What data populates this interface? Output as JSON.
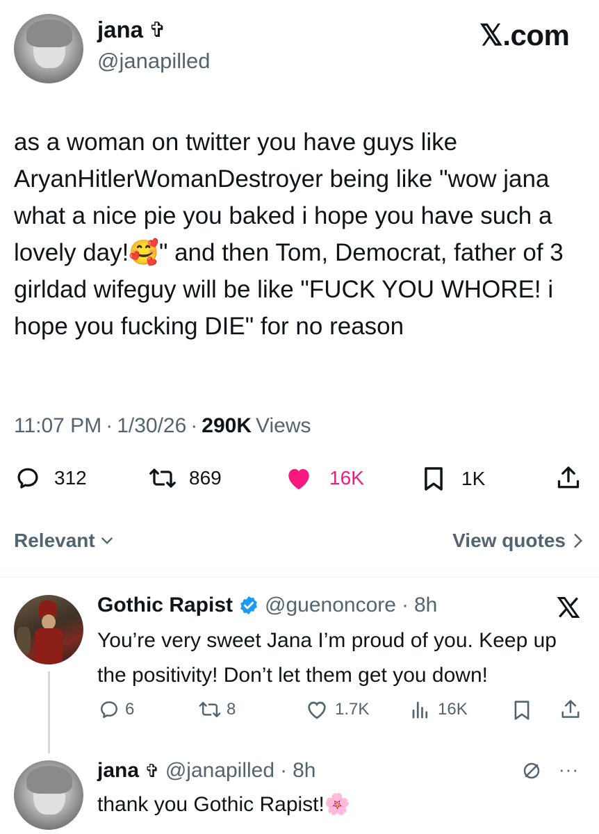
{
  "tweet": {
    "author_name": "jana",
    "author_badge": "✞",
    "handle": "@janapilled",
    "brand": "𝕏.com",
    "body": "as a woman on twitter you have guys like AryanHitlerWomanDestroyer being like \"wow jana what a nice pie you baked i hope you have such a lovely day!🥰\" and then Tom, Democrat, father of 3 girldad wifeguy will be like \"FUCK YOU WHORE! i hope you fucking DIE\" for no reason",
    "time": "11:07 PM",
    "date": "1/30/26",
    "views_count": "290K",
    "views_label": "Views",
    "actions": {
      "replies": "312",
      "retweets": "869",
      "likes": "16K",
      "bookmarks": "1K"
    },
    "like_color": "#f91880"
  },
  "sort": {
    "label": "Relevant",
    "quotes_label": "View quotes"
  },
  "replies": [
    {
      "name": "Gothic Rapist",
      "handle": "@guenoncore",
      "time": "8h",
      "text": "You’re very sweet Jana I’m proud of you. Keep up the positivity! Don’t let them get you down!",
      "actions": {
        "replies": "6",
        "retweets": "8",
        "likes": "1.7K",
        "views": "16K"
      },
      "verified_color": "#1d9bf0"
    },
    {
      "name": "jana",
      "badge": "✞",
      "handle": "@janapilled",
      "time": "8h",
      "text": "thank you Gothic Rapist!🌸"
    }
  ]
}
